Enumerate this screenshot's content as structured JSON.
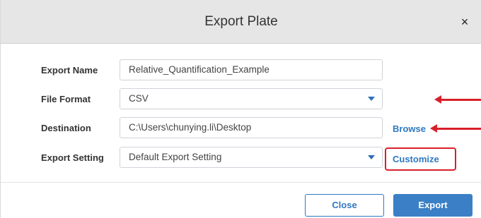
{
  "dialog": {
    "title": "Export Plate",
    "close_icon": "close-icon",
    "close_glyph": "×"
  },
  "form": {
    "export_name": {
      "label": "Export Name",
      "value": "Relative_Quantification_Example"
    },
    "file_format": {
      "label": "File Format",
      "value": "CSV"
    },
    "destination": {
      "label": "Destination",
      "value": "C:\\Users\\chunying.li\\Desktop",
      "browse_label": "Browse"
    },
    "export_setting": {
      "label": "Export Setting",
      "value": "Default Export Setting",
      "customize_label": "Customize"
    }
  },
  "footer": {
    "close_label": "Close",
    "export_label": "Export"
  },
  "annotations": {
    "arrow_color": "#d8202a",
    "highlight_color": "#d8202a"
  },
  "colors": {
    "accent": "#2f78c1",
    "primary_button": "#3b80c6",
    "titlebar": "#e6e6e6"
  }
}
